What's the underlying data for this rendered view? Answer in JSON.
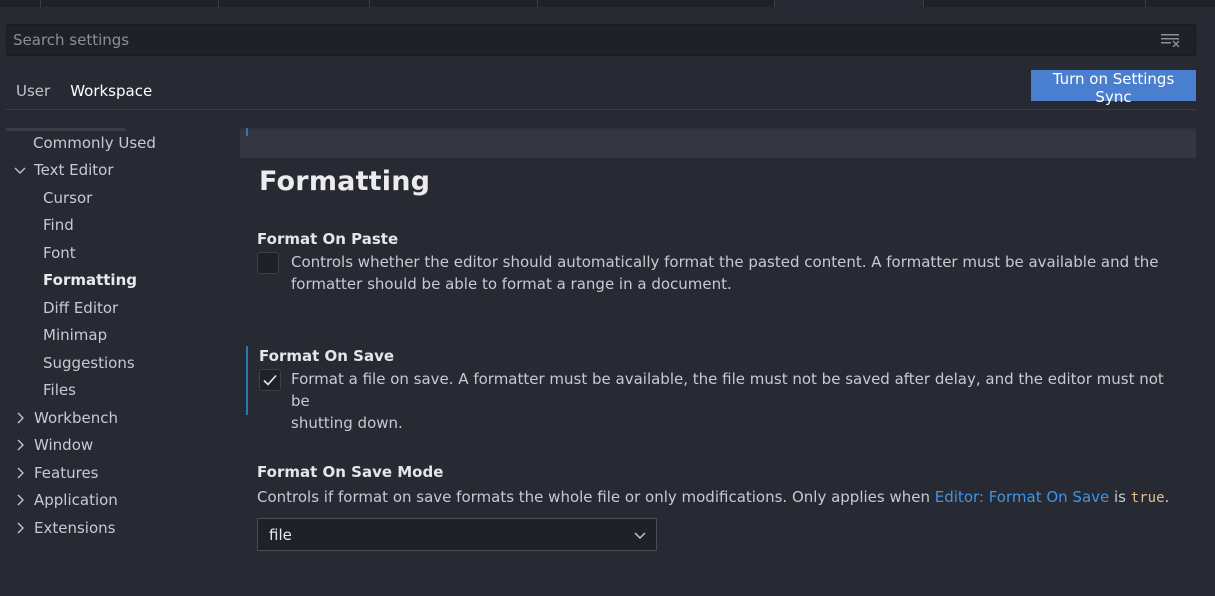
{
  "search": {
    "placeholder": "Search settings",
    "clear_icon": "clear-filter-icon"
  },
  "scope_tabs": [
    {
      "label": "User",
      "active": false
    },
    {
      "label": "Workspace",
      "active": true
    }
  ],
  "sync_button": {
    "label": "Turn on Settings Sync",
    "color": "#4a7fd0"
  },
  "sidebar": {
    "items": [
      {
        "label": "Commonly Used",
        "level": 1,
        "expandable": false
      },
      {
        "label": "Text Editor",
        "level": 1,
        "expandable": true,
        "expanded": true
      },
      {
        "label": "Cursor",
        "level": 2
      },
      {
        "label": "Find",
        "level": 2
      },
      {
        "label": "Font",
        "level": 2
      },
      {
        "label": "Formatting",
        "level": 2,
        "selected": true
      },
      {
        "label": "Diff Editor",
        "level": 2
      },
      {
        "label": "Minimap",
        "level": 2
      },
      {
        "label": "Suggestions",
        "level": 2
      },
      {
        "label": "Files",
        "level": 2
      },
      {
        "label": "Workbench",
        "level": 1,
        "expandable": true,
        "expanded": false
      },
      {
        "label": "Window",
        "level": 1,
        "expandable": true,
        "expanded": false
      },
      {
        "label": "Features",
        "level": 1,
        "expandable": true,
        "expanded": false
      },
      {
        "label": "Application",
        "level": 1,
        "expandable": true,
        "expanded": false
      },
      {
        "label": "Extensions",
        "level": 1,
        "expandable": true,
        "expanded": false
      }
    ]
  },
  "main": {
    "section_title": "Formatting",
    "settings": [
      {
        "title": "Format On Paste",
        "checked": false,
        "description_line1": "Controls whether the editor should automatically format the pasted content. A formatter must be available and the",
        "description_line2": "formatter should be able to format a range in a document."
      },
      {
        "title": "Format On Save",
        "checked": true,
        "focused": true,
        "description_line1": "Format a file on save. A formatter must be available, the file must not be saved after delay, and the editor must not be",
        "description_line2": "shutting down."
      },
      {
        "title": "Format On Save Mode",
        "description_prefix": "Controls if format on save formats the whole file or only modifications. Only applies when ",
        "description_link": "Editor: Format On Save",
        "description_mid": " is ",
        "description_code": "true",
        "description_suffix": ".",
        "select_value": "file"
      }
    ]
  },
  "colors": {
    "background": "#272a33",
    "accent": "#2b79a8",
    "link": "#3f94e8"
  }
}
